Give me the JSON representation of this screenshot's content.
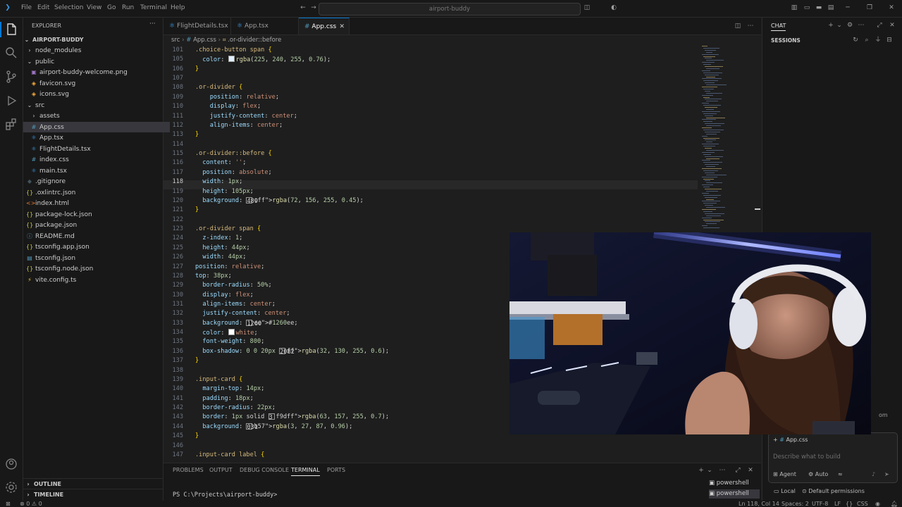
{
  "titlebar": {
    "menu": [
      "File",
      "Edit",
      "Selection",
      "View",
      "Go",
      "Run",
      "Terminal",
      "Help"
    ],
    "search": "airport-buddy"
  },
  "explorer": {
    "header": "EXPLORER",
    "root": "AIRPORT-BUDDY",
    "items": [
      {
        "label": "node_modules",
        "kind": "folder-closed"
      },
      {
        "label": "public",
        "kind": "folder-open"
      },
      {
        "label": "airport-buddy-welcome.png",
        "kind": "image"
      },
      {
        "label": "favicon.svg",
        "kind": "svg"
      },
      {
        "label": "icons.svg",
        "kind": "svg"
      },
      {
        "label": "src",
        "kind": "folder-open"
      },
      {
        "label": "assets",
        "kind": "folder-closed"
      },
      {
        "label": "App.css",
        "kind": "css"
      },
      {
        "label": "App.tsx",
        "kind": "tsx"
      },
      {
        "label": "FlightDetails.tsx",
        "kind": "tsx"
      },
      {
        "label": "index.css",
        "kind": "css"
      },
      {
        "label": "main.tsx",
        "kind": "tsx"
      },
      {
        "label": ".gitignore",
        "kind": "git"
      },
      {
        "label": ".oxlintrc.json",
        "kind": "json"
      },
      {
        "label": "index.html",
        "kind": "html"
      },
      {
        "label": "package-lock.json",
        "kind": "json"
      },
      {
        "label": "package.json",
        "kind": "json"
      },
      {
        "label": "README.md",
        "kind": "md"
      },
      {
        "label": "tsconfig.app.json",
        "kind": "json"
      },
      {
        "label": "tsconfig.json",
        "kind": "tsjson"
      },
      {
        "label": "tsconfig.node.json",
        "kind": "json"
      },
      {
        "label": "vite.config.ts",
        "kind": "ts"
      }
    ],
    "outline": "OUTLINE",
    "timeline": "TIMELINE"
  },
  "tabs": [
    {
      "label": "FlightDetails.tsx",
      "active": false
    },
    {
      "label": "App.tsx",
      "active": false
    },
    {
      "label": "App.css",
      "active": true
    }
  ],
  "breadcrumb": {
    "a": "src",
    "b": "App.css",
    "c": ".or-divider::before"
  },
  "code": {
    "current_line": 118,
    "lines": [
      {
        "n": "101",
        "t": ".choice-button span {"
      },
      {
        "n": "105",
        "t": "  color: ■rgba(225, 240, 255, 0.76);"
      },
      {
        "n": "106",
        "t": "}"
      },
      {
        "n": "107",
        "t": ""
      },
      {
        "n": "108",
        "t": ".or-divider {"
      },
      {
        "n": "109",
        "t": "    position: relative;"
      },
      {
        "n": "110",
        "t": "    display: flex;"
      },
      {
        "n": "111",
        "t": "    justify-content: center;"
      },
      {
        "n": "112",
        "t": "    align-items: center;"
      },
      {
        "n": "113",
        "t": "}"
      },
      {
        "n": "114",
        "t": ""
      },
      {
        "n": "115",
        "t": ".or-divider::before {"
      },
      {
        "n": "116",
        "t": "  content: '';"
      },
      {
        "n": "117",
        "t": "  position: absolute;"
      },
      {
        "n": "118",
        "t": "  width: 1px;"
      },
      {
        "n": "119",
        "t": "  height: 105px;"
      },
      {
        "n": "120",
        "t": "  background: ■rgba(72, 156, 255, 0.45);"
      },
      {
        "n": "121",
        "t": "}"
      },
      {
        "n": "122",
        "t": ""
      },
      {
        "n": "123",
        "t": ".or-divider span {"
      },
      {
        "n": "124",
        "t": "  z-index: 1;"
      },
      {
        "n": "125",
        "t": "  height: 44px;"
      },
      {
        "n": "126",
        "t": "  width: 44px;"
      },
      {
        "n": "127",
        "t": "position: relative;"
      },
      {
        "n": "128",
        "t": "top: 38px;"
      },
      {
        "n": "129",
        "t": "  border-radius: 50%;"
      },
      {
        "n": "130",
        "t": "  display: flex;"
      },
      {
        "n": "131",
        "t": "  align-items: center;"
      },
      {
        "n": "132",
        "t": "  justify-content: center;"
      },
      {
        "n": "133",
        "t": "  background: ■#1260ee;"
      },
      {
        "n": "134",
        "t": "  color: ■white;"
      },
      {
        "n": "135",
        "t": "  font-weight: 800;"
      },
      {
        "n": "136",
        "t": "  box-shadow: 0 0 20px ■rgba(32, 130, 255, 0.6);"
      },
      {
        "n": "137",
        "t": "}"
      },
      {
        "n": "138",
        "t": ""
      },
      {
        "n": "139",
        "t": ".input-card {"
      },
      {
        "n": "140",
        "t": "  margin-top: 14px;"
      },
      {
        "n": "141",
        "t": "  padding: 18px;"
      },
      {
        "n": "142",
        "t": "  border-radius: 22px;"
      },
      {
        "n": "143",
        "t": "  border: 1px solid ■rgba(63, 157, 255, 0.7);"
      },
      {
        "n": "144",
        "t": "  background: ■rgba(3, 27, 87, 0.96);"
      },
      {
        "n": "145",
        "t": "}"
      },
      {
        "n": "146",
        "t": ""
      },
      {
        "n": "147",
        "t": ".input-card label {"
      }
    ]
  },
  "panel": {
    "tabs": [
      "PROBLEMS",
      "OUTPUT",
      "DEBUG CONSOLE",
      "TERMINAL",
      "PORTS"
    ],
    "active_tab": "TERMINAL",
    "prompt": "PS C:\\Projects\\airport-buddy>",
    "terminals": [
      "powershell",
      "powershell"
    ]
  },
  "chat": {
    "title": "CHAT",
    "sessions": "SESSIONS",
    "context_chip": "App.css",
    "placeholder": "Describe what to build",
    "mode": "Agent",
    "model": "Auto",
    "location": "Local",
    "permissions": "Default permissions",
    "partial_text": "om"
  },
  "status": {
    "problems": "⊗ 0 ⚠ 0",
    "position": "Ln 118, Col 14",
    "spaces": "Spaces: 2",
    "encoding": "UTF-8",
    "eol": "LF",
    "language": "CSS"
  },
  "colors": {
    "swatch_105": "#e1f0ff",
    "swatch_120": "#489cff",
    "swatch_133": "#1260ee",
    "swatch_134": "#ffffff",
    "swatch_136": "#2082ff",
    "swatch_143": "#3f9dff",
    "swatch_144": "#031b57"
  }
}
